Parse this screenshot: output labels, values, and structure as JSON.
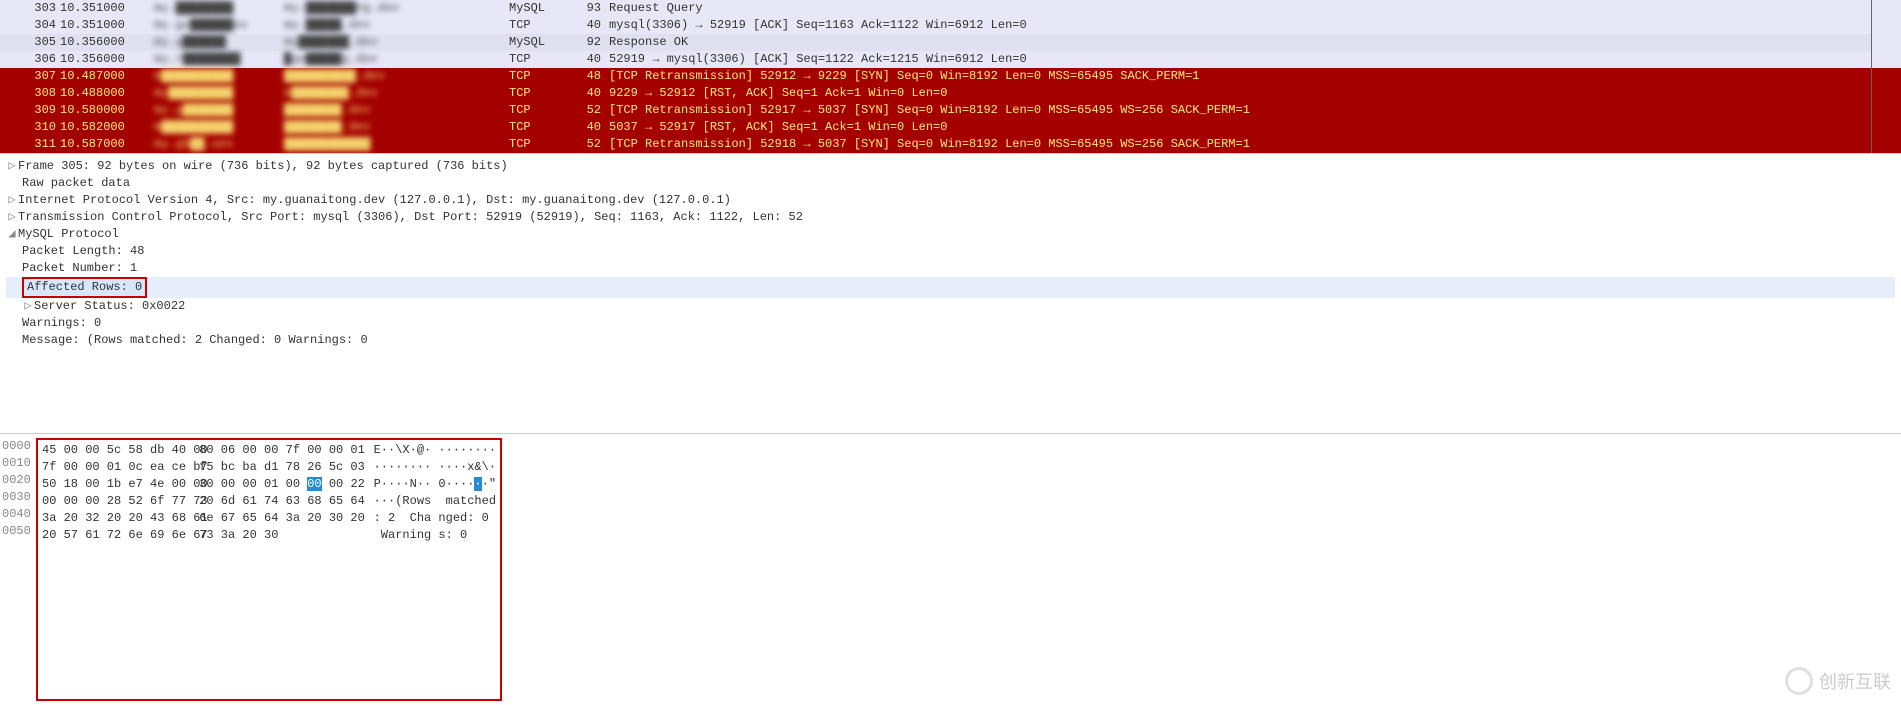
{
  "packets": [
    {
      "no": "303",
      "time": "10.351000",
      "src": "my.████████",
      "dst": "my.███████ng.dev",
      "proto": "MySQL",
      "len": "93",
      "info": "Request Query",
      "cls": "normal"
    },
    {
      "no": "304",
      "time": "10.351000",
      "src": "my.gu██████ev",
      "dst": "my.█████.dev",
      "proto": "TCP",
      "len": "40",
      "info": "mysql(3306) → 52919 [ACK] Seq=1163 Ack=1122 Win=6912 Len=0",
      "cls": "normal"
    },
    {
      "no": "305",
      "time": "10.356000",
      "src": "my.g██████",
      "dst": "my███████.dev",
      "proto": "MySQL",
      "len": "92",
      "info": "Response OK",
      "cls": "selected"
    },
    {
      "no": "306",
      "time": "10.356000",
      "src": "my.г████████",
      "dst": "█gu█████g.dev",
      "proto": "TCP",
      "len": "40",
      "info": "52919 → mysql(3306) [ACK] Seq=1122 Ack=1215 Win=6912 Len=0",
      "cls": "normal"
    },
    {
      "no": "307",
      "time": "10.487000",
      "src": "m██████████",
      "dst": "██████████.dev",
      "proto": "TCP",
      "len": "48",
      "info": "[TCP Retransmission] 52912 → 9229 [SYN] Seq=0 Win=8192 Len=0 MSS=65495 SACK_PERM=1",
      "cls": "red"
    },
    {
      "no": "308",
      "time": "10.488000",
      "src": "my█████████",
      "dst": "m████████.dev",
      "proto": "TCP",
      "len": "40",
      "info": "9229 → 52912 [RST, ACK] Seq=1 Ack=1 Win=0 Len=0",
      "cls": "red"
    },
    {
      "no": "309",
      "time": "10.580000",
      "src": "my.g███████",
      "dst": "████████.dev",
      "proto": "TCP",
      "len": "52",
      "info": "[TCP Retransmission] 52917 → 5037 [SYN] Seq=0 Win=8192 Len=0 MSS=65495 WS=256 SACK_PERM=1",
      "cls": "red"
    },
    {
      "no": "310",
      "time": "10.582000",
      "src": "m██████████",
      "dst": "████████.dev",
      "proto": "TCP",
      "len": "40",
      "info": "5037 → 52917 [RST, ACK] Seq=1 Ack=1 Win=0 Len=0",
      "cls": "red"
    },
    {
      "no": "311",
      "time": "10.587000",
      "src": "my.gb██.uev",
      "dst": "████████████",
      "proto": "TCP",
      "len": "52",
      "info": "[TCP Retransmission] 52918 → 5037 [SYN] Seq=0 Win=8192 Len=0 MSS=65495 WS=256 SACK_PERM=1",
      "cls": "red"
    }
  ],
  "details": {
    "frame": "Frame 305: 92 bytes on wire (736 bits), 92 bytes captured (736 bits)",
    "raw": "Raw packet data",
    "ip": "Internet Protocol Version 4, Src: my.guanaitong.dev (127.0.0.1), Dst: my.guanaitong.dev (127.0.0.1)",
    "tcp": "Transmission Control Protocol, Src Port: mysql (3306), Dst Port: 52919 (52919), Seq: 1163, Ack: 1122, Len: 52",
    "mysql": "MySQL Protocol",
    "plen": "Packet Length: 48",
    "pnum": "Packet Number: 1",
    "affect": "Affected Rows: 0",
    "status": "Server Status: 0x0022",
    "warn": "Warnings: 0",
    "msg": "Message: (Rows matched: 2  Changed: 0  Warnings: 0"
  },
  "tw": {
    "closed": "▷",
    "open": "◢"
  },
  "hex": {
    "offsets": [
      "0000",
      "0010",
      "0020",
      "0030",
      "0040",
      "0050"
    ],
    "rows": [
      {
        "b1": "45 00 00 5c 58 db 40 00",
        "b2": "80 06 00 00 7f 00 00 01",
        "a": "E··\\X·@· ········"
      },
      {
        "b1": "7f 00 00 01 0c ea ce b7",
        "b2": "f5 bc ba d1 78 26 5c 03",
        "a": "········ ····x&\\·"
      },
      {
        "b1": "50 18 00 1b e7 4e 00 00",
        "b2": "30 00 00 01 00 ",
        "hl": "00",
        "b2b": " 00 22",
        "a": "P····N·· 0····",
        "hlA": "·",
        "a2": "·\""
      },
      {
        "b1": "00 00 00 28 52 6f 77 73",
        "b2": "20 6d 61 74 63 68 65 64",
        "a": "···(Rows  matched"
      },
      {
        "b1": "3a 20 32 20 20 43 68 61",
        "b2": "6e 67 65 64 3a 20 30 20",
        "a": ": 2  Cha nged: 0 "
      },
      {
        "b1": "20 57 61 72 6e 69 6e 67",
        "b2": "73 3a 20 30",
        "a": " Warning s: 0"
      }
    ]
  },
  "watermark": "创新互联"
}
